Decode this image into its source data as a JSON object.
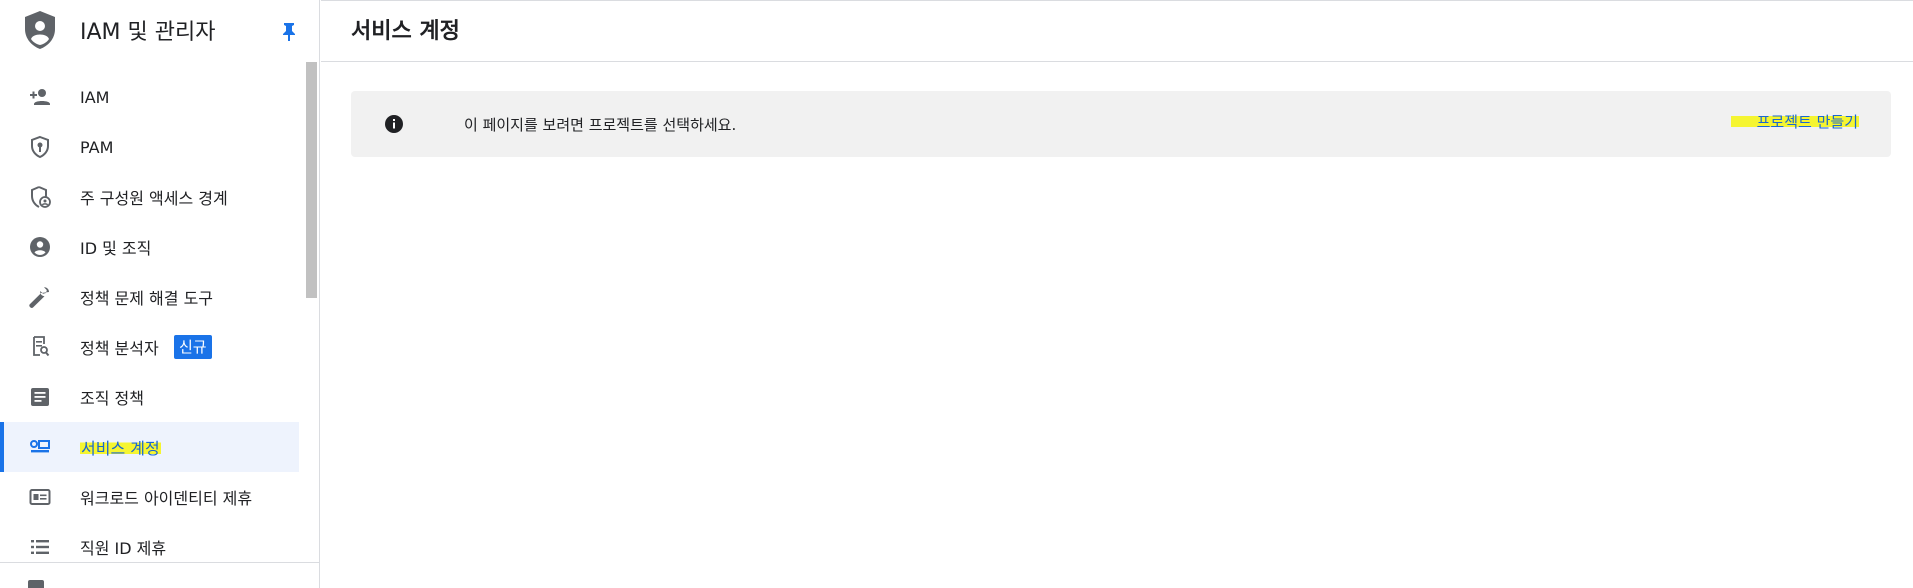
{
  "sidebar": {
    "title": "IAM 및 관리자",
    "items": [
      {
        "label": "IAM",
        "icon": "person-add-icon"
      },
      {
        "label": "PAM",
        "icon": "shield-key-icon"
      },
      {
        "label": "주 구성원 액세스 경계",
        "icon": "shield-person-icon"
      },
      {
        "label": "ID 및 조직",
        "icon": "account-circle-icon"
      },
      {
        "label": "정책 문제 해결 도구",
        "icon": "wrench-icon"
      },
      {
        "label": "정책 분석자",
        "icon": "policy-search-icon",
        "badge": "신규"
      },
      {
        "label": "조직 정책",
        "icon": "article-icon"
      },
      {
        "label": "서비스 계정",
        "icon": "service-account-icon",
        "active": true
      },
      {
        "label": "워크로드 아이덴티티 제휴",
        "icon": "id-card-icon"
      },
      {
        "label": "직원 ID 제휴",
        "icon": "list-icon"
      }
    ]
  },
  "main": {
    "page_title": "서비스 계정",
    "banner": {
      "message": "이 페이지를 보려면 프로젝트를 선택하세요.",
      "action_label": "프로젝트 만들기"
    }
  },
  "colors": {
    "accent": "#1a73e8",
    "active_bg": "#eef3fd",
    "highlight": "#f5f531",
    "banner_bg": "#f1f1f1",
    "icon": "#5f6368"
  }
}
